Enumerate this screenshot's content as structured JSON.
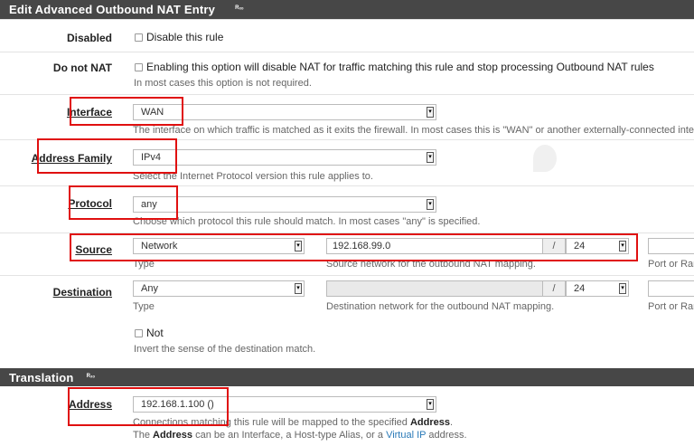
{
  "header": {
    "title": "Edit Advanced Outbound NAT Entry",
    "watermark": "Rₓₒ"
  },
  "disabled": {
    "label": "Disabled",
    "checkbox_label": "Disable this rule"
  },
  "do_not_nat": {
    "label": "Do not NAT",
    "checkbox_label": "Enabling this option will disable NAT for traffic matching this rule and stop processing Outbound NAT rules",
    "hint": "In most cases this option is not required."
  },
  "interface": {
    "label": "Interface",
    "value": "WAN",
    "hint": "The interface on which traffic is matched as it exits the firewall. In most cases this is \"WAN\" or another externally-connected interface."
  },
  "address_family": {
    "label": "Address Family",
    "value": "IPv4",
    "hint": "Select the Internet Protocol version this rule applies to."
  },
  "protocol": {
    "label": "Protocol",
    "value": "any",
    "hint": "Choose which protocol this rule should match. In most cases \"any\" is specified."
  },
  "source": {
    "label": "Source",
    "type_value": "Network",
    "type_hint": "Type",
    "address_value": "192.168.99.0",
    "slash": "/",
    "mask_value": "24",
    "address_hint": "Source network for the outbound NAT mapping.",
    "port_hint": "Port or Ran"
  },
  "destination": {
    "label": "Destination",
    "type_value": "Any",
    "type_hint": "Type",
    "address_value": "",
    "slash": "/",
    "mask_value": "24",
    "address_hint": "Destination network for the outbound NAT mapping.",
    "port_hint": "Port or Ran",
    "not_label": "Not",
    "not_hint": "Invert the sense of the destination match."
  },
  "translation_header": {
    "title": "Translation",
    "watermark": "Rₓₒ"
  },
  "translation_address": {
    "label": "Address",
    "value": "192.168.1.100 ()",
    "hint_line1_pre": "Connections matching this rule will be mapped to the specified ",
    "hint_line1_bold": "Address",
    "hint_line1_post": ".",
    "hint_line2_pre": "The ",
    "hint_line2_bold": "Address",
    "hint_line2_mid": " can be an Interface, a Host-type Alias, or a ",
    "hint_line2_link": "Virtual IP",
    "hint_line2_post": " address."
  },
  "colors": {
    "header_bg": "#474747",
    "highlight": "#e01010",
    "link": "#2a7ab8"
  }
}
